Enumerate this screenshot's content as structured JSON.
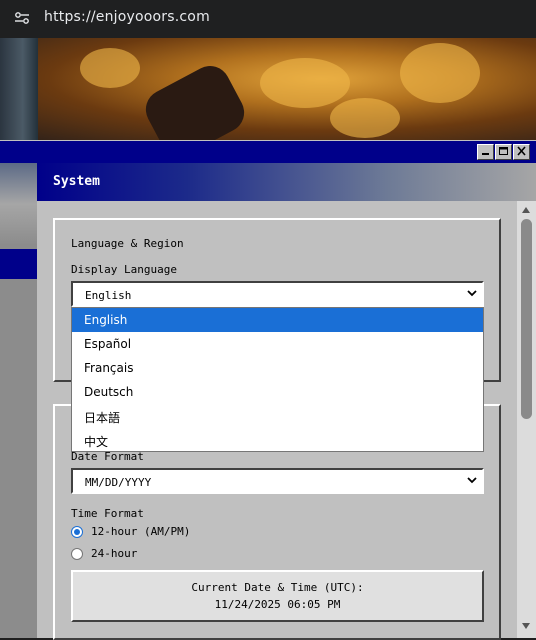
{
  "browser": {
    "url": "https://enjoyooors.com"
  },
  "window": {
    "panel_title": "System",
    "controls": [
      "minimize",
      "maximize",
      "close"
    ]
  },
  "language_section": {
    "heading": "Language & Region",
    "display_language_label": "Display Language",
    "selected": "English",
    "options": [
      "English",
      "Español",
      "Français",
      "Deutsch",
      "日本語",
      "中文"
    ]
  },
  "datetime_section": {
    "date_format_label": "Date Format",
    "date_format_value": "MM/DD/YYYY",
    "time_format_label": "Time Format",
    "time_options": [
      {
        "label": "12-hour (AM/PM)",
        "checked": true
      },
      {
        "label": "24-hour",
        "checked": false
      }
    ],
    "clock_title": "Current Date & Time (UTC):",
    "clock_value": "11/24/2025 06:05 PM"
  },
  "colors": {
    "title_bar": "#00008a",
    "dropdown_highlight": "#1a6fd6",
    "window_face": "#c0c0c0"
  }
}
